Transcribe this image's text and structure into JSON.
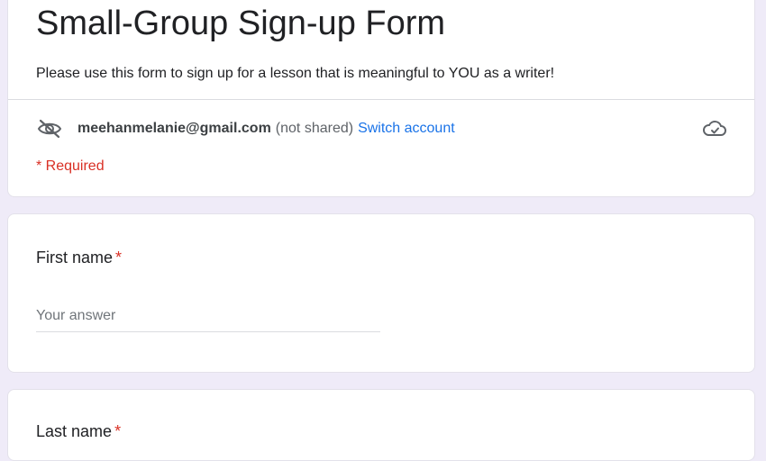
{
  "form": {
    "title": "Small-Group Sign-up Form",
    "description": "Please use this form to sign up for a lesson that is meaningful to YOU as a writer!",
    "account": {
      "email": "meehanmelanie@gmail.com",
      "shared_note": "(not shared)",
      "switch_label": "Switch account"
    },
    "required_note": "* Required",
    "questions": [
      {
        "label": "First name",
        "required_mark": "*",
        "placeholder": "Your answer",
        "value": ""
      },
      {
        "label": "Last name",
        "required_mark": "*"
      }
    ]
  },
  "icons": {
    "hidden": "eye-off-icon",
    "cloud": "cloud-check-icon"
  },
  "colors": {
    "page_background": "#efebf8",
    "required": "#d93025",
    "link": "#1a73e8"
  }
}
